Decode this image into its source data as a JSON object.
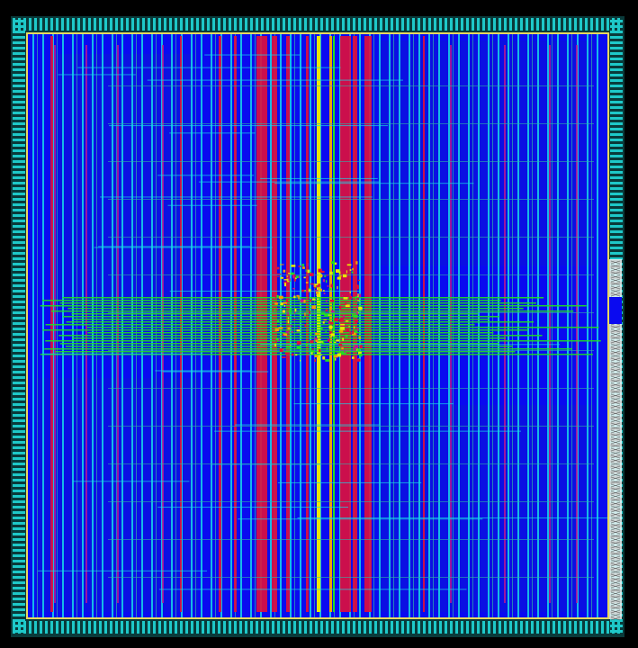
{
  "colors": {
    "background": "#000000",
    "io_ring": "#1ec8c8",
    "io_ring_dark": "#0a3a3a",
    "core_fill": "#0a0af0",
    "core_fill_dark": "#1020c8",
    "power_stripe_red": "#e0103a",
    "power_stripe_magenta": "#c01890",
    "signal_cyan": "#18d8e8",
    "signal_teal": "#30b0a8",
    "signal_green": "#20e020",
    "signal_yellow": "#e8e800",
    "signal_orange": "#f0a000",
    "pin_white": "#f0f0f0",
    "core_boundary": "#e8d860"
  },
  "icons": {
    "pin_marker": "x-mark-icon",
    "pad_cell": "io-pad-icon"
  }
}
